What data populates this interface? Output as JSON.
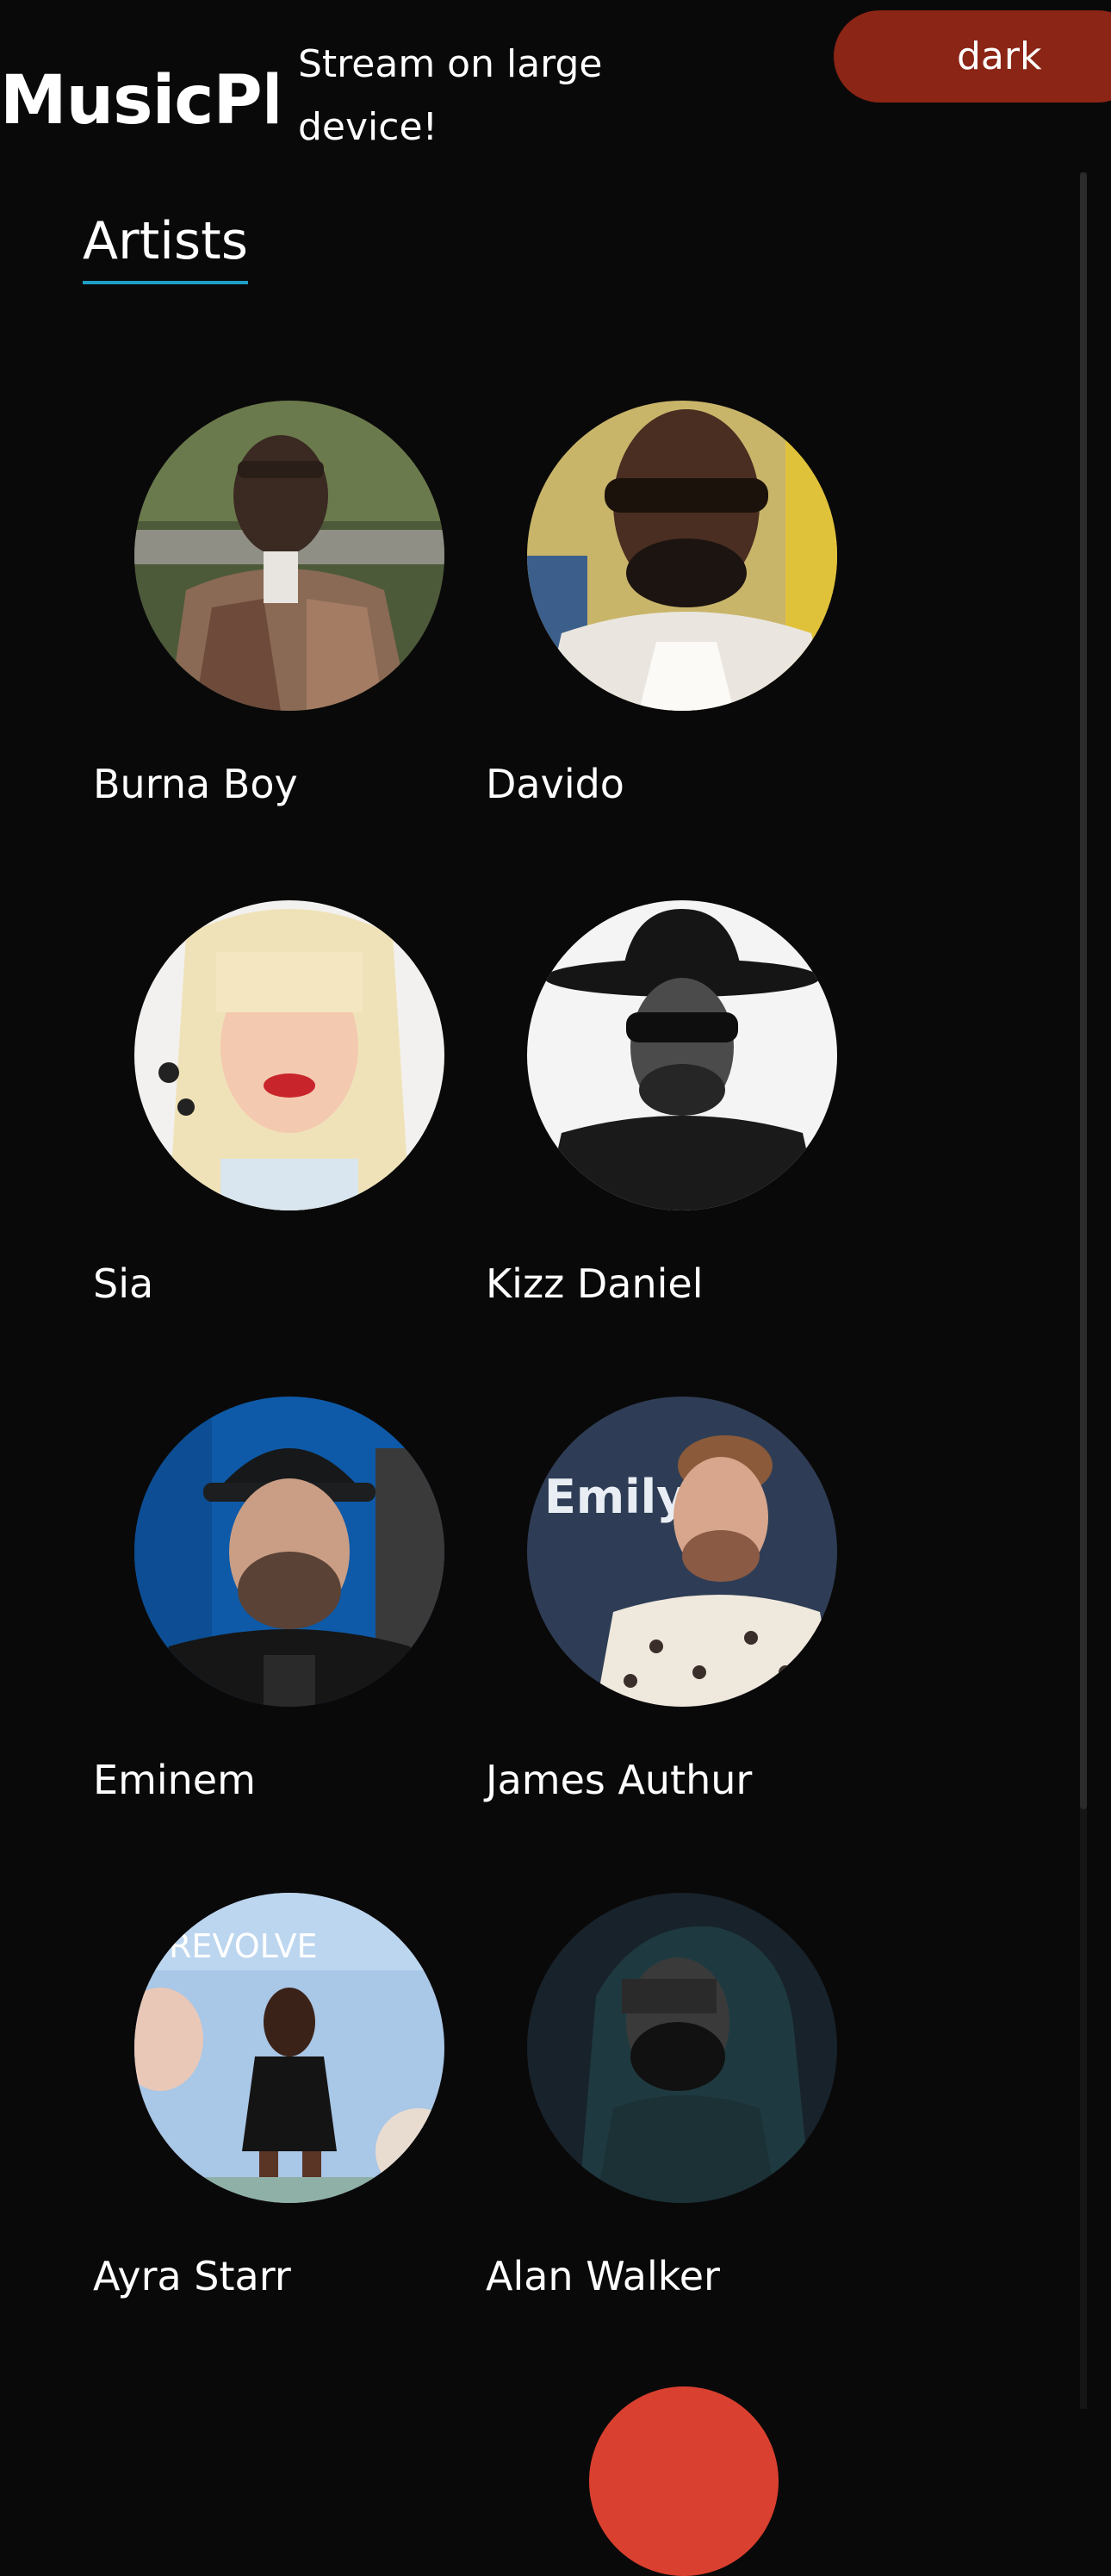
{
  "header": {
    "app_title": "MusicPla",
    "promo_text": "Stream on large device!",
    "theme_toggle_label": "dark"
  },
  "section": {
    "heading": "Artists",
    "accent_color": "#1e9fc6"
  },
  "artists": [
    {
      "name": "Burna Boy"
    },
    {
      "name": "Davido"
    },
    {
      "name": "Sia"
    },
    {
      "name": "Kizz Daniel"
    },
    {
      "name": "Eminem"
    },
    {
      "name": "James Authur"
    },
    {
      "name": "Ayra Starr"
    },
    {
      "name": "Alan Walker"
    }
  ],
  "colors": {
    "background": "#0a0909",
    "toggle": "#8b2515",
    "fab": "#d9402f"
  }
}
